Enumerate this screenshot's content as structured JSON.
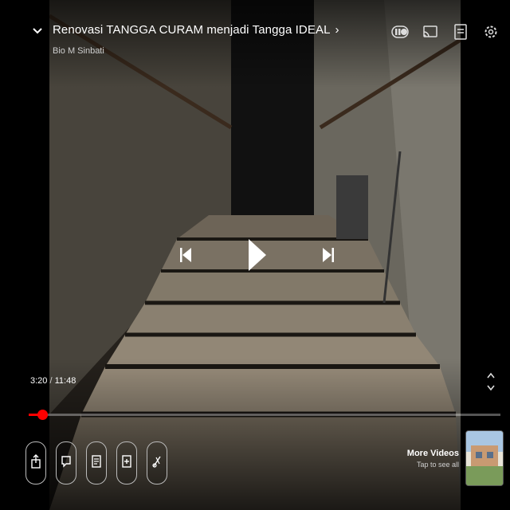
{
  "video": {
    "title": "Renovasi TANGGA CURAM menjadi Tangga IDEAL",
    "channel": "Bio M Sinbati"
  },
  "playback": {
    "current_time": "3:20",
    "separator": "/",
    "duration": "11:48",
    "progress_fraction": 0.028,
    "state": "paused"
  },
  "top_icons": [
    "pause-toggle-icon",
    "cast-icon",
    "captions-icon",
    "settings-icon"
  ],
  "center_controls": [
    "previous-icon",
    "play-icon",
    "next-icon"
  ],
  "actions": [
    "share-icon",
    "comment-icon",
    "save-icon",
    "add-to-playlist-icon",
    "clip-icon"
  ],
  "more_videos": {
    "title": "More Videos",
    "subtitle": "Tap to see all"
  },
  "colors": {
    "progress": "#ff0000",
    "text": "#ffffff"
  }
}
